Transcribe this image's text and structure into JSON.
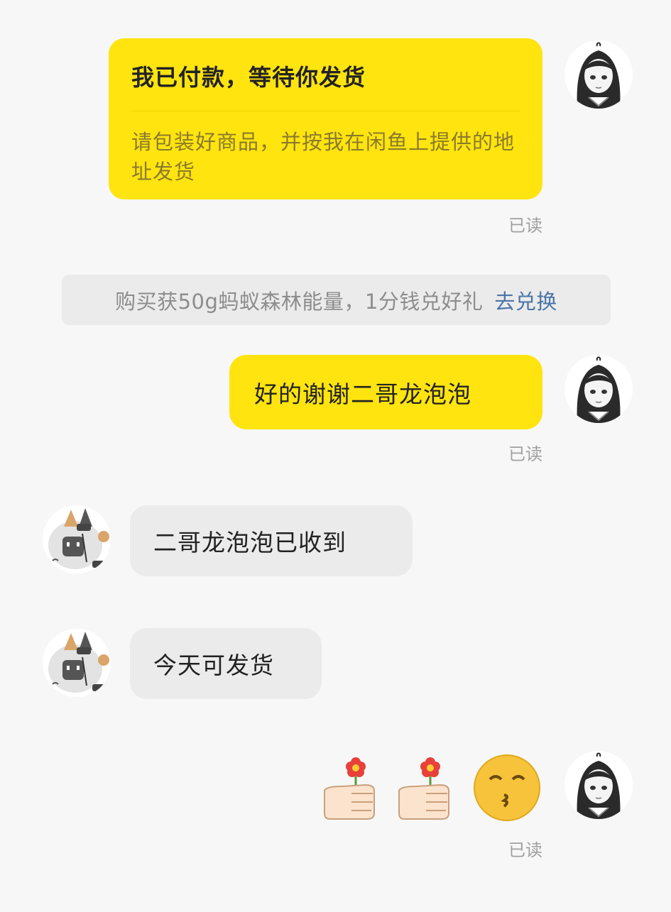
{
  "messages": {
    "order_card": {
      "title": "我已付款，等待你发货",
      "body": "请包装好商品，并按我在闲鱼上提供的地址发货",
      "status": "已读"
    },
    "system_notice": {
      "text": "购买获50g蚂蚁森林能量，1分钱兑好礼",
      "link": "去兑换"
    },
    "reply_1": {
      "text": "好的谢谢二哥龙泡泡",
      "status": "已读"
    },
    "seller_1": {
      "text": "二哥龙泡泡已收到"
    },
    "seller_2": {
      "text": "今天可发货"
    },
    "emoji_message": {
      "emojis": [
        "thumb-flower-icon",
        "thumb-flower-icon",
        "kissing-face-icon"
      ],
      "status": "已读"
    }
  },
  "colors": {
    "my_bubble": "#ffe40f",
    "their_bubble": "#ebebeb",
    "link": "#4a75a8",
    "background": "#f7f7f7"
  }
}
